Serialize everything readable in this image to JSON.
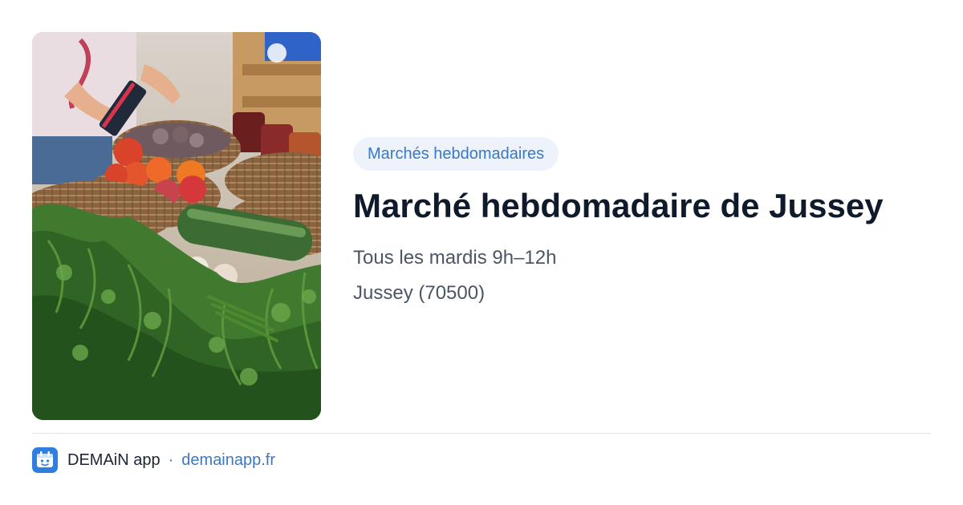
{
  "card": {
    "image_alt": "Étal de marché avec légumes frais",
    "category": "Marchés hebdomadaires",
    "title": "Marché hebdomadaire de Jussey",
    "schedule": "Tous les mardis 9h–12h",
    "location": "Jussey (70500)"
  },
  "footer": {
    "app_name": "DEMAiN app",
    "separator": "·",
    "url": "demainapp.fr"
  },
  "colors": {
    "accent": "#3b78c4",
    "tag_background": "#eef3fb",
    "title": "#0f1b2d",
    "meta": "#4a5565",
    "logo_background": "#2f7fe0"
  },
  "icons": {
    "app_logo": "demain-app-icon"
  }
}
